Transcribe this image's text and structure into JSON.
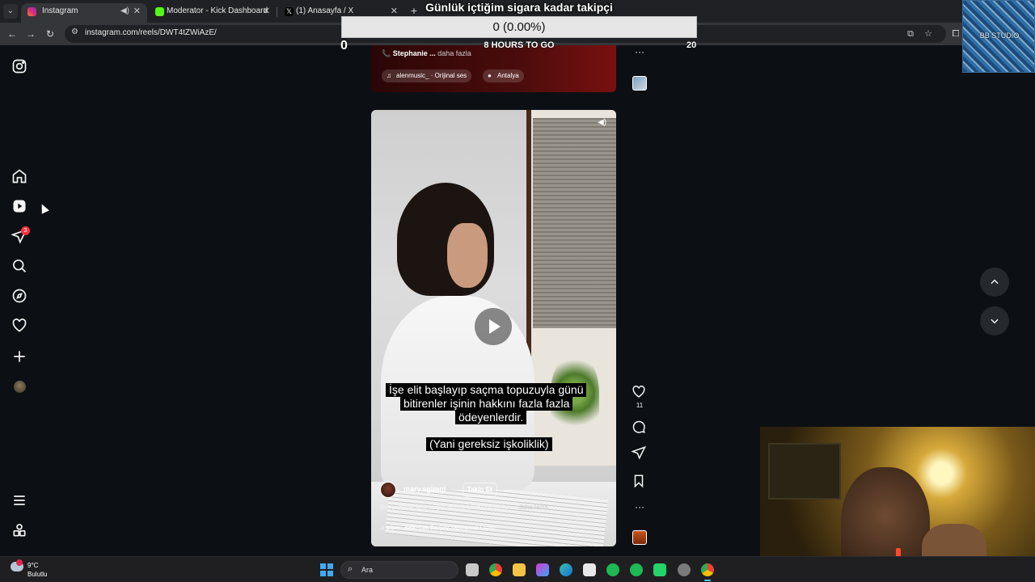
{
  "browser": {
    "tabs": [
      {
        "title": "Instagram",
        "active": true
      },
      {
        "title": "Moderator - Kick Dashboard",
        "active": false
      },
      {
        "title": "(1) Anasayfa / X",
        "active": false
      }
    ],
    "url": "instagram.com/reels/DWT4tZWiAzE/"
  },
  "overlay": {
    "goal_title": "Günlük içtiğim sigara kadar takipçi",
    "goal_value": "0 (0.00%)",
    "goal_progress": 0,
    "goal_min": "0",
    "goal_max": "20",
    "goal_time": "8 HOURS TO GO",
    "logo_text": "BB STUDIO"
  },
  "sidebar": {
    "items": [
      {
        "icon": "instagram-logo-icon"
      },
      {
        "icon": "home-icon"
      },
      {
        "icon": "reels-icon"
      },
      {
        "icon": "messages-icon",
        "badge": "3"
      },
      {
        "icon": "search-icon"
      },
      {
        "icon": "explore-icon"
      },
      {
        "icon": "notifications-icon"
      },
      {
        "icon": "create-icon"
      },
      {
        "icon": "profile-avatar"
      },
      {
        "icon": "menu-icon"
      },
      {
        "icon": "also-from-meta-icon"
      }
    ]
  },
  "prev_reel": {
    "user": "Stephanie ...",
    "more": "daha fazla",
    "audio": "alenmusic_ · Orijinal ses",
    "location": "Antalya"
  },
  "reel": {
    "subtitle_lines": [
      "İşe elit başlayıp saçma topuzuyla günü",
      "bitirenler işinin hakkını fazla fazla",
      "ödeyenlerdir."
    ],
    "subtitle_note": "(Yani gereksiz işkoliklik)",
    "username": "mary.sgimgl",
    "follow_label": "Takip Et",
    "caption": "Bet sesimle size eziyet etmek istemediğim içi ...",
    "caption_more": "daha fazla",
    "music": "gripin · Belki Çok Da Şey Yapmamak Lazım",
    "likes": "11"
  },
  "taskbar": {
    "temperature": "9°C",
    "condition": "Bulutlu",
    "search_placeholder": "Ara"
  },
  "colors": {
    "page_bg": "#0c1014",
    "goal_fill": "#53fc18",
    "badge": "#ff3040"
  }
}
